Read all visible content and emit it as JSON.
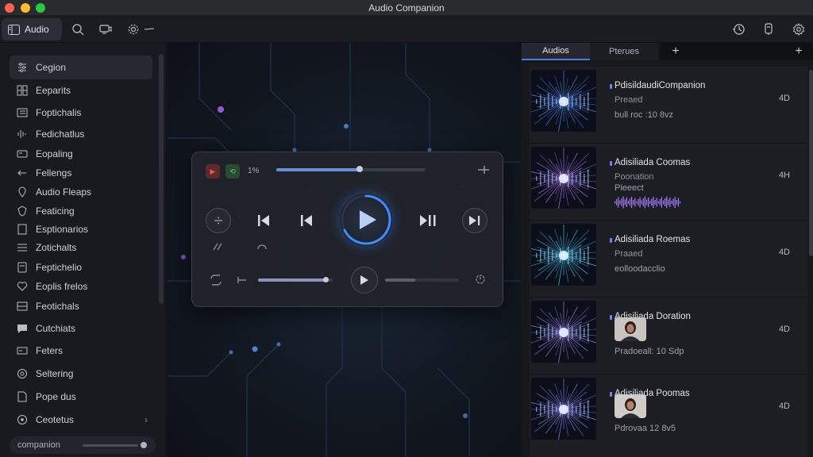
{
  "window": {
    "title": "Audio Companion"
  },
  "toolbar": {
    "tab_label": "Audio"
  },
  "sidebar": {
    "items": [
      {
        "label": "Cegion",
        "icon": "equalizer-icon"
      },
      {
        "label": "Eeparits",
        "icon": "grid-icon"
      },
      {
        "label": "Foptichalis",
        "icon": "list-icon"
      },
      {
        "label": "Fedichatlus",
        "icon": "waveform-icon"
      },
      {
        "label": "Eopaling",
        "icon": "card-icon"
      },
      {
        "label": "Fellengs",
        "icon": "arrows-icon"
      },
      {
        "label": "Audio Fleaps",
        "icon": "location-pin-icon"
      },
      {
        "label": "Featicing",
        "icon": "shield-icon"
      },
      {
        "label": "Esptionarios",
        "icon": "document-icon"
      },
      {
        "label": "Zotichalts",
        "icon": "rows-icon"
      },
      {
        "label": "Feptichelio",
        "icon": "page-icon"
      },
      {
        "label": "Eoplis frelos",
        "icon": "heart-icon"
      },
      {
        "label": "Feotichals",
        "icon": "rows-icon"
      },
      {
        "label": "Cutchiats",
        "icon": "chat-icon"
      },
      {
        "label": "Feters",
        "icon": "tag-icon"
      },
      {
        "label": "Seltering",
        "icon": "settings-icon"
      },
      {
        "label": "Pope dus",
        "icon": "file-icon"
      },
      {
        "label": "Ceotetus",
        "icon": "gear-icon"
      }
    ],
    "footer_label": "companion"
  },
  "player": {
    "percent_label": "1%",
    "progress": 0.56,
    "lower_progress": 0.9
  },
  "right_panel": {
    "tabs": [
      "Audios",
      "Pterues"
    ],
    "items": [
      {
        "title": "PdisildaudiCompanion",
        "sub": "Preaed",
        "meta": "bull roc :10 8vz",
        "tag": "4D",
        "hue": "#5d8bff"
      },
      {
        "title": "Adisiliada Coomas",
        "sub": "Poonation",
        "meta": "Pieeect",
        "tag": "4H",
        "hue": "#c37cff"
      },
      {
        "title": "Adisiliada Roemas",
        "sub": "Praaed",
        "meta": "eolloodacclio",
        "tag": "4D",
        "hue": "#4fd5ff"
      },
      {
        "title": "Adisiliada Doration",
        "sub": "",
        "meta": "Pradoeall: 10 Sdp",
        "tag": "4D",
        "hue": "#a88cff"
      },
      {
        "title": "Adisiliada Poomas",
        "sub": "",
        "meta": "Pdrovaa 12 8v5",
        "tag": "4D",
        "hue": "#9c8cff"
      }
    ]
  }
}
